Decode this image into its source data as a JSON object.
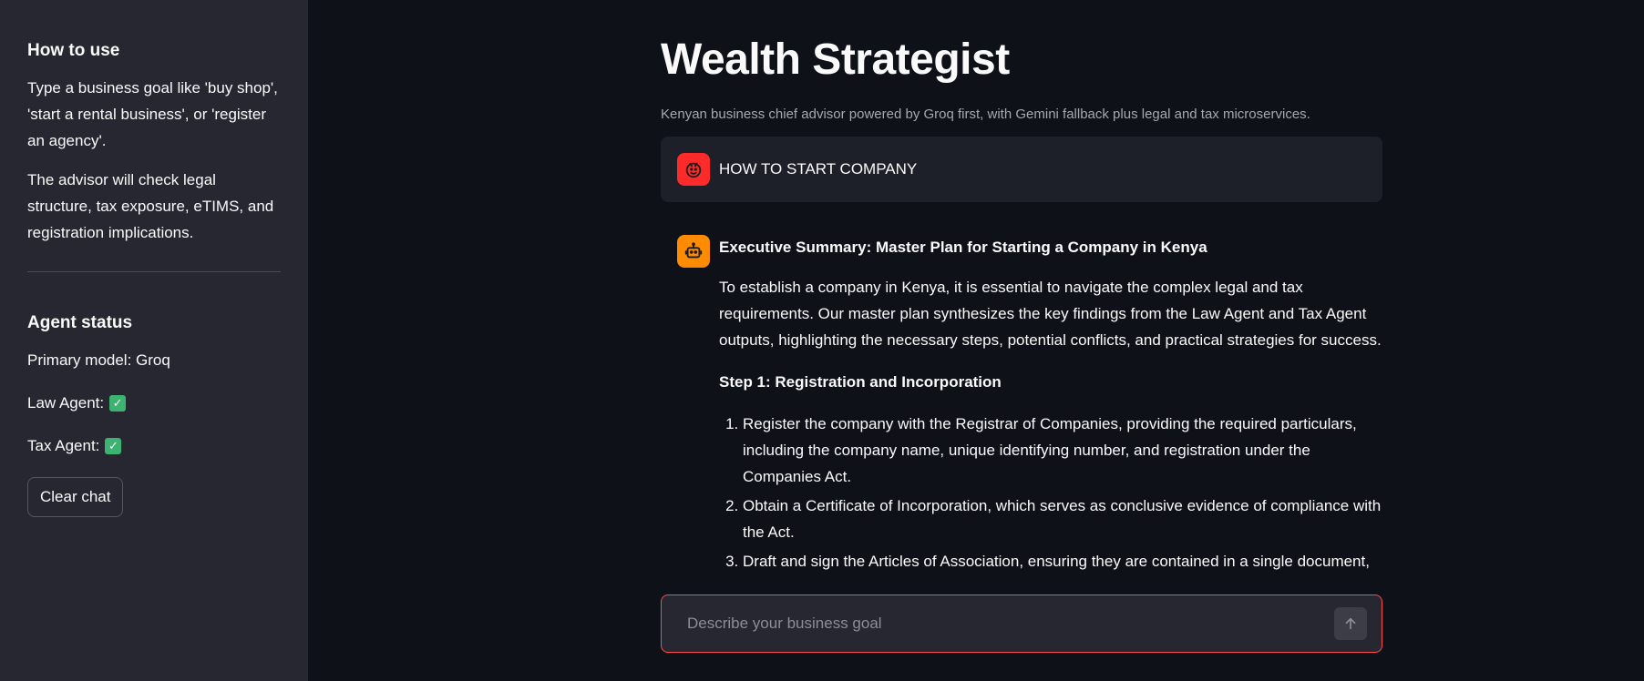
{
  "sidebar": {
    "how_to_use": {
      "title": "How to use",
      "paragraphs": [
        "Type a business goal like 'buy shop', 'start a rental business', or 'register an agency'.",
        "The advisor will check legal structure, tax exposure, eTIMS, and registration implications."
      ]
    },
    "agent_status": {
      "title": "Agent status",
      "primary_model": "Primary model: Groq",
      "law_agent": "Law Agent:",
      "tax_agent": "Tax Agent:"
    },
    "clear_chat_label": "Clear chat"
  },
  "main": {
    "title": "Wealth Strategist",
    "subtitle": "Kenyan business chief advisor powered by Groq first, with Gemini fallback plus legal and tax microservices.",
    "user_message": "HOW TO START COMPANY",
    "assistant": {
      "heading": "Executive Summary: Master Plan for Starting a Company in Kenya",
      "intro": "To establish a company in Kenya, it is essential to navigate the complex legal and tax requirements. Our master plan synthesizes the key findings from the Law Agent and Tax Agent outputs, highlighting the necessary steps, potential conflicts, and practical strategies for success.",
      "step_title": "Step 1: Registration and Incorporation",
      "steps": [
        "Register the company with the Registrar of Companies, providing the required particulars, including the company name, unique identifying number, and registration under the Companies Act.",
        "Obtain a Certificate of Incorporation, which serves as conclusive evidence of compliance with the Act.",
        "Draft and sign the Articles of Association, ensuring they are contained in a single document,"
      ]
    },
    "chat_input": {
      "placeholder": "Describe your business goal"
    }
  },
  "colors": {
    "sidebar_bg": "#262730",
    "main_bg": "#0e1117",
    "user_avatar": "#ff2b2b",
    "assistant_avatar": "#ff8c00",
    "input_border": "#ff4b4b",
    "check": "#3cb371"
  },
  "icons": {
    "user_avatar": "smiley-face-icon",
    "assistant_avatar": "robot-icon",
    "status_check": "check-mark-icon",
    "send": "arrow-up-icon"
  }
}
